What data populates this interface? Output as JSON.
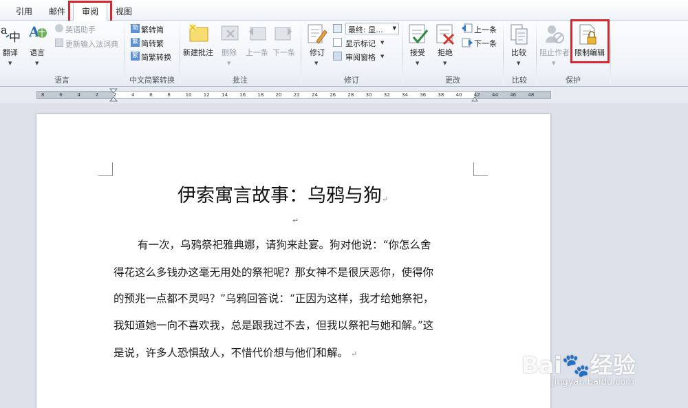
{
  "tabs": [
    {
      "label": "引用"
    },
    {
      "label": "邮件"
    },
    {
      "label": "审阅",
      "active": true
    },
    {
      "label": "视图"
    }
  ],
  "ribbon": {
    "language": {
      "group_label": "语言",
      "translate": "翻译",
      "language": "语言",
      "english_assistant": "英语助手",
      "update_ime_dict": "更新输入法词典"
    },
    "chinese_conversion": {
      "group_label": "中文简繁转换",
      "to_simplified": "繁转简",
      "to_traditional": "简转繁",
      "convert": "简繁转换"
    },
    "comments": {
      "group_label": "批注",
      "new_comment": "新建批注",
      "delete": "删除",
      "previous": "上一条",
      "next": "下一条"
    },
    "tracking": {
      "group_label": "修订",
      "track_changes": "修订",
      "display_for_review": "最终: 显...",
      "show_markup": "显示标记",
      "reviewing_pane": "审阅窗格"
    },
    "changes": {
      "group_label": "更改",
      "accept": "接受",
      "reject": "拒绝",
      "previous": "上一条",
      "next": "下一条"
    },
    "compare": {
      "group_label": "比较",
      "compare": "比较"
    },
    "protect": {
      "group_label": "保护",
      "block_authors": "阻止作者",
      "restrict_editing": "限制编辑"
    }
  },
  "ruler": {
    "ticks": [
      "8",
      "6",
      "4",
      "2",
      "2",
      "4",
      "6",
      "8",
      "10",
      "12",
      "14",
      "16",
      "18",
      "20",
      "22",
      "24",
      "26",
      "28",
      "30",
      "32",
      "34",
      "36",
      "38",
      "40",
      "42",
      "44",
      "46",
      "48"
    ]
  },
  "document": {
    "title": "伊索寓言故事：乌鸦与狗",
    "paragraph_mark": "↵",
    "lines": [
      "有一次，乌鸦祭祀雅典娜，请狗来赴宴。狗对他说：“你怎么舍",
      "得花这么多钱办这毫无用处的祭祀呢？那女神不是很厌恶你，使得你",
      "的预兆一点都不灵吗？”乌鸦回答说：“正因为这样，我才给她祭祀，",
      "我知道她一向不喜欢我，总是跟我过不去，但我以祭祀与她和解。”这",
      "是说，许多人恐惧敌人，不惜代价想与他们和解。"
    ]
  },
  "watermark": {
    "brand": "Bai🐾经验",
    "url": "jingyan.baidu.com"
  },
  "colors": {
    "highlight_red": "#d7262c",
    "ribbon_bg": "#f1f4f9",
    "doc_bg": "#dde2ea"
  }
}
